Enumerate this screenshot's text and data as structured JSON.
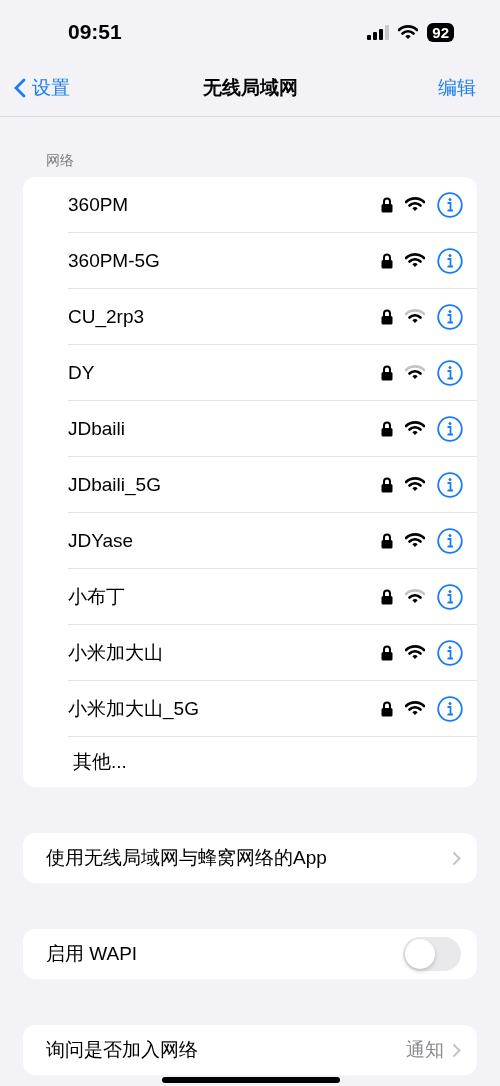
{
  "status_bar": {
    "time": "09:51",
    "battery": "92"
  },
  "nav": {
    "back": "设置",
    "title": "无线局域网",
    "action": "编辑"
  },
  "networks_section": {
    "header": "网络",
    "networks": [
      {
        "name": "360PM",
        "weak": false
      },
      {
        "name": "360PM-5G",
        "weak": false
      },
      {
        "name": "CU_2rp3",
        "weak": true
      },
      {
        "name": "DY",
        "weak": true
      },
      {
        "name": "JDbaili",
        "weak": false
      },
      {
        "name": "JDbaili_5G",
        "weak": false
      },
      {
        "name": "JDYase",
        "weak": false
      },
      {
        "name": "小布丁",
        "weak": true
      },
      {
        "name": "小米加大山",
        "weak": false
      },
      {
        "name": "小米加大山_5G",
        "weak": false
      }
    ],
    "other": "其他..."
  },
  "settings": [
    {
      "kind": "link",
      "label": "使用无线局域网与蜂窝网络的App"
    },
    {
      "kind": "toggle",
      "label": "启用 WAPI",
      "on": false
    },
    {
      "kind": "value",
      "label": "询问是否加入网络",
      "value": "通知"
    }
  ]
}
